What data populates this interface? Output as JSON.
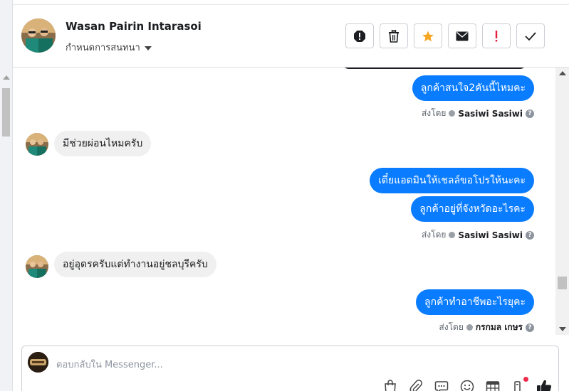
{
  "header": {
    "user_name": "Wasan Pairin Intarasoi",
    "assign_label": "กำหนดการสนทนา",
    "toolbar_icons": [
      "spam-icon",
      "trash-icon",
      "star-icon",
      "mail-icon",
      "exclamation-icon",
      "check-icon"
    ],
    "colors": {
      "star": "#f5a623",
      "exclamation": "#e41e3f"
    }
  },
  "messages": {
    "m1": "ลูกค้าสนใจ2คันนี้ไหมคะ",
    "s1_prefix": "ส่งโดย",
    "s1_name": "Sasiwi Sasiwi",
    "m2": "มีช่วยผ่อนไหมครับ",
    "m3": "เดี๋ยแอดมินให้เชลล์ขอโปรให้นะคะ",
    "m4": "ลูกค้าอยู่ที่จังหวัดอะไรคะ",
    "s2_prefix": "ส่งโดย",
    "s2_name": "Sasiwi Sasiwi",
    "m5": "อยู่อุดรครับแต่ทำงานอยู่ชลบุรีครับ",
    "m6": "ลูกค้าทำอาชีพอะไรยุคะ",
    "s3_prefix": "ส่งโดย",
    "s3_name": "กรกมล เกษร"
  },
  "composer": {
    "placeholder": "ตอบกลับใน Messenger..."
  },
  "colors": {
    "outgoing_bubble": "#0a7cff",
    "incoming_bubble": "#f0f0f0"
  }
}
